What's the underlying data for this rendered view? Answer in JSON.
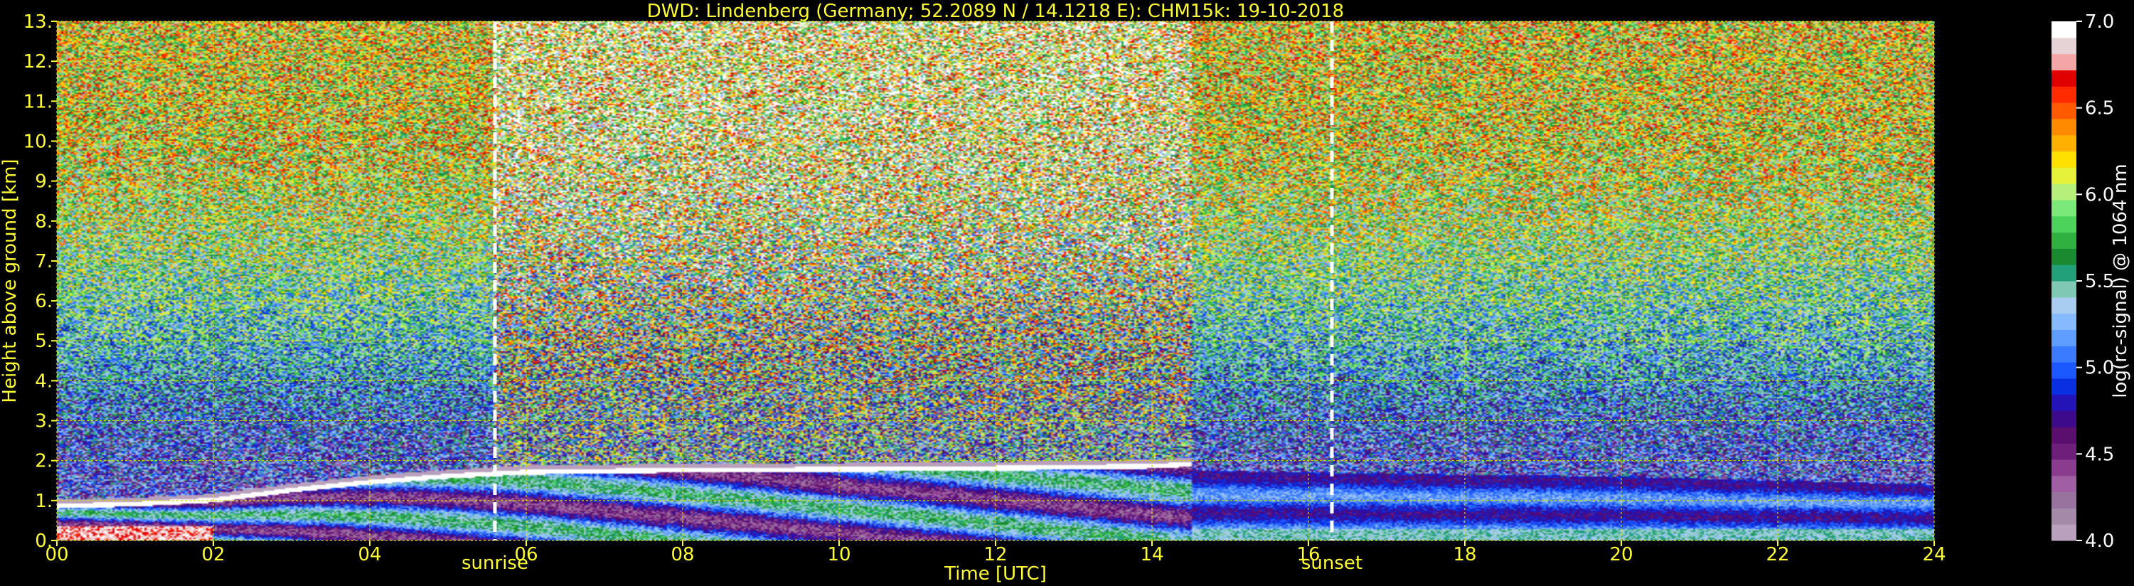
{
  "chart_data": {
    "type": "heatmap",
    "title": "DWD: Lindenberg (Germany; 52.2089 N / 14.1218 E):    CHM15k: 19-10-2018",
    "xlabel": "Time [UTC]",
    "ylabel": "Height above ground [km]",
    "xlim": [
      0,
      24
    ],
    "ylim": [
      0,
      13
    ],
    "x_ticks": [
      0,
      2,
      4,
      6,
      8,
      10,
      12,
      14,
      16,
      18,
      20,
      22,
      24
    ],
    "x_tick_labels": [
      "00",
      "02",
      "04",
      "06",
      "08",
      "10",
      "12",
      "14",
      "16",
      "18",
      "20",
      "22",
      "24"
    ],
    "y_ticks": [
      0,
      1,
      2,
      3,
      4,
      5,
      6,
      7,
      8,
      9,
      10,
      11,
      12,
      13
    ],
    "y_tick_labels": [
      "0.",
      "1.",
      "2.",
      "3.",
      "4.",
      "5.",
      "6.",
      "7.",
      "8.",
      "9.",
      "10.",
      "11.",
      "12.",
      "13."
    ],
    "grid": true,
    "annotations": [
      {
        "text": "sunrise",
        "x": 5.6
      },
      {
        "text": "sunset",
        "x": 16.3
      }
    ],
    "colorbar": {
      "label": "log(rc-signal) @ 1064 nm",
      "range": [
        4.0,
        7.0
      ],
      "ticks": [
        4.0,
        4.5,
        5.0,
        5.5,
        6.0,
        6.5,
        7.0
      ],
      "tick_labels": [
        "4.0",
        "4.5",
        "5.0",
        "5.5",
        "6.0",
        "6.5",
        "7.0"
      ],
      "colors": [
        "#b9a1bd",
        "#a48aa8",
        "#97739e",
        "#a15fa3",
        "#8a3d8e",
        "#6e1f7a",
        "#5a0e6e",
        "#3d0a8c",
        "#2414b8",
        "#0a2fe0",
        "#1c58ff",
        "#3b7bff",
        "#5f9dff",
        "#86b9ff",
        "#a8cdf0",
        "#7fc8b4",
        "#22a07a",
        "#1a8a30",
        "#2fb040",
        "#4bd35c",
        "#7be87a",
        "#b6f07a",
        "#e6f23a",
        "#ffe000",
        "#ffb000",
        "#ff8a00",
        "#ff5a00",
        "#ff2a00",
        "#e00000",
        "#f4a6a6",
        "#e6d3d6",
        "#ffffff"
      ]
    },
    "layers": [
      {
        "name": "noise_profile",
        "levels": [
          [
            0,
            4.8
          ],
          [
            1.5,
            4.9
          ],
          [
            3,
            5.1
          ],
          [
            4.5,
            5.4
          ],
          [
            6,
            5.6
          ],
          [
            7.5,
            5.8
          ],
          [
            9,
            5.95
          ],
          [
            10.5,
            6.05
          ],
          [
            13,
            6.15
          ]
        ]
      },
      {
        "name": "boundary_layer_top",
        "points": [
          [
            0,
            0.8
          ],
          [
            1,
            0.85
          ],
          [
            2,
            0.95
          ],
          [
            3,
            1.2
          ],
          [
            4,
            1.4
          ],
          [
            5,
            1.55
          ],
          [
            6,
            1.65
          ],
          [
            8,
            1.7
          ],
          [
            10,
            1.72
          ],
          [
            12,
            1.75
          ],
          [
            14,
            1.8
          ],
          [
            14.5,
            1.85
          ]
        ]
      },
      {
        "name": "night_layer_top",
        "points": [
          [
            14.5,
            1.75
          ],
          [
            16,
            1.7
          ],
          [
            18,
            1.65
          ],
          [
            20,
            1.6
          ],
          [
            22,
            1.5
          ],
          [
            24,
            1.4
          ]
        ]
      }
    ]
  }
}
